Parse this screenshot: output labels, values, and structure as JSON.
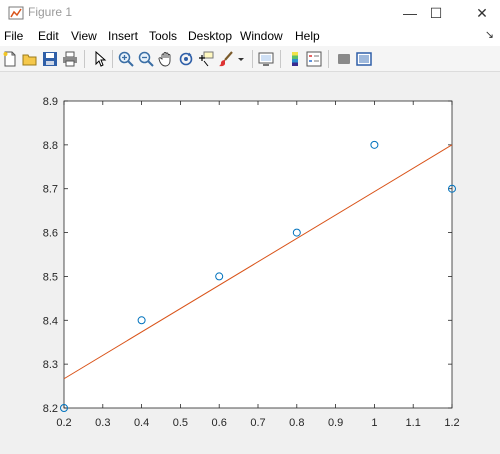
{
  "window": {
    "title": "Figure 1",
    "minimize_glyph": "—",
    "maximize_glyph": "☐",
    "close_glyph": "✕"
  },
  "menu": {
    "items": [
      "File",
      "Edit",
      "View",
      "Insert",
      "Tools",
      "Desktop",
      "Window",
      "Help"
    ],
    "overflow_glyph": "↘"
  },
  "toolbar": {
    "buttons": [
      "new-figure-icon",
      "open-file-icon",
      "save-icon",
      "print-icon",
      "edit-plot-arrow-icon",
      "zoom-in-icon",
      "zoom-out-icon",
      "pan-hand-icon",
      "rotate-3d-icon",
      "data-cursor-icon",
      "brush-icon",
      "brush-dropdown-icon",
      "link-plot-icon",
      "colorbar-icon",
      "legend-icon",
      "hide-plot-tools-icon",
      "show-plot-tools-icon"
    ]
  },
  "colors": {
    "marker": "#0072bd",
    "fit_line": "#d95319",
    "axes_background": "#ffffff",
    "figure_background": "#f0f0f0"
  },
  "chart_data": {
    "type": "scatter",
    "title": "",
    "xlabel": "",
    "ylabel": "",
    "xlim": [
      0.2,
      1.2
    ],
    "ylim": [
      8.2,
      8.9
    ],
    "xticks": [
      "0.2",
      "0.3",
      "0.4",
      "0.5",
      "0.6",
      "0.7",
      "0.8",
      "0.9",
      "1",
      "1.1",
      "1.2"
    ],
    "yticks": [
      "8.2",
      "8.3",
      "8.4",
      "8.5",
      "8.6",
      "8.7",
      "8.8",
      "8.9"
    ],
    "grid": false,
    "series": [
      {
        "type": "scatter",
        "marker": "circle",
        "x": [
          0.2,
          0.4,
          0.6,
          0.8,
          1.0,
          1.2
        ],
        "y": [
          8.2,
          8.4,
          8.5,
          8.6,
          8.8,
          8.7
        ]
      },
      {
        "type": "line",
        "x": [
          0.2,
          1.2
        ],
        "y": [
          8.2667,
          8.8
        ]
      }
    ]
  }
}
